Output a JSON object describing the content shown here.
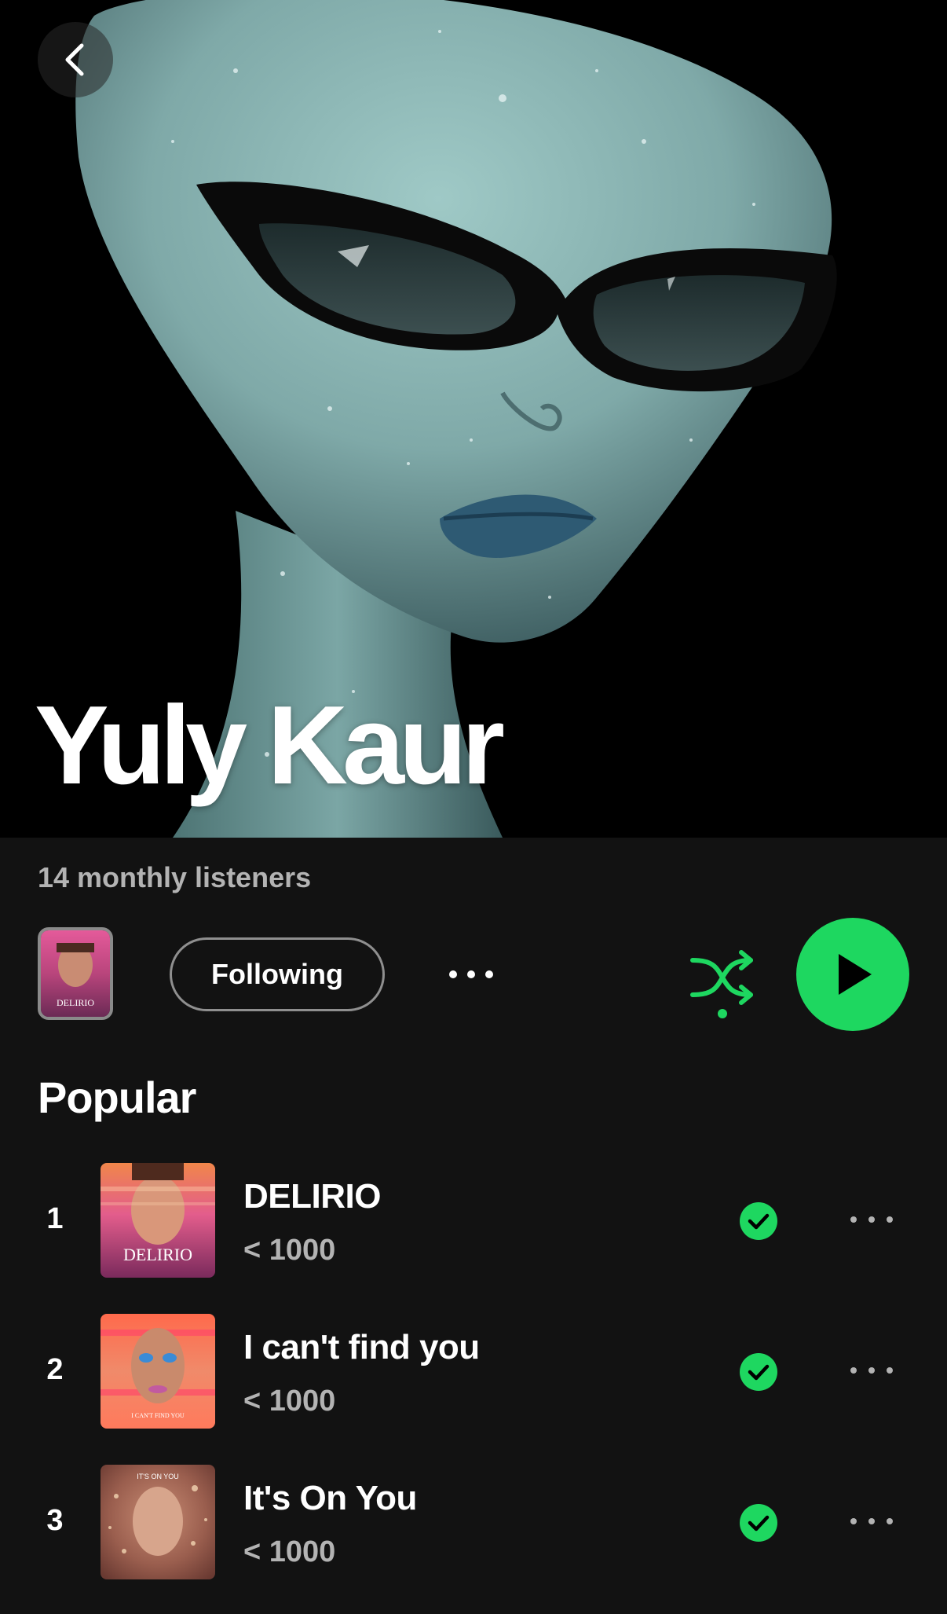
{
  "artist": {
    "name": "Yuly Kaur",
    "monthly_listeners": "14 monthly listeners"
  },
  "actions": {
    "follow_label": "Following",
    "thumbnail_text": "DELIRIO"
  },
  "popular": {
    "title": "Popular",
    "tracks": [
      {
        "rank": "1",
        "title": "DELIRIO",
        "plays": "< 1000",
        "cover_text": "DELIRIO"
      },
      {
        "rank": "2",
        "title": "I can't find you",
        "plays": "< 1000",
        "cover_text": "I CAN'T FIND YOU"
      },
      {
        "rank": "3",
        "title": "It's On You",
        "plays": "< 1000",
        "cover_text": "IT'S ON YOU"
      }
    ]
  },
  "colors": {
    "accent": "#1ed760",
    "background": "#121212",
    "secondary_text": "#b3b3b3"
  },
  "icons": {
    "back": "chevron-left-icon",
    "more": "more-horizontal-icon",
    "shuffle": "shuffle-icon",
    "play": "play-icon",
    "downloaded": "check-circle-icon"
  }
}
